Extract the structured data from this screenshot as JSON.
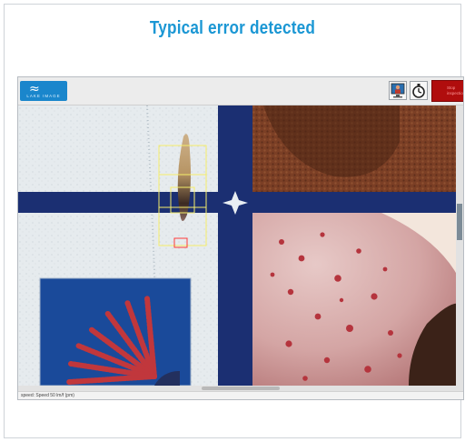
{
  "heading": "Typical error detected",
  "toolbar": {
    "logo_text": "LAKE IMAGE",
    "monitor_icon": "monitor-person-icon",
    "timer_icon": "stopwatch-icon",
    "stop_label": "Stop inspection"
  },
  "status": {
    "text": "speed: Speed 50 lm/f (pm)"
  },
  "colors": {
    "heading": "#1b97d4",
    "stop_button": "#b00d0d",
    "logo_bg": "#1a86cc",
    "blue_band": "#1b2f72",
    "detection_box": "#f5ee6a",
    "error_box": "#ff3b3b"
  }
}
